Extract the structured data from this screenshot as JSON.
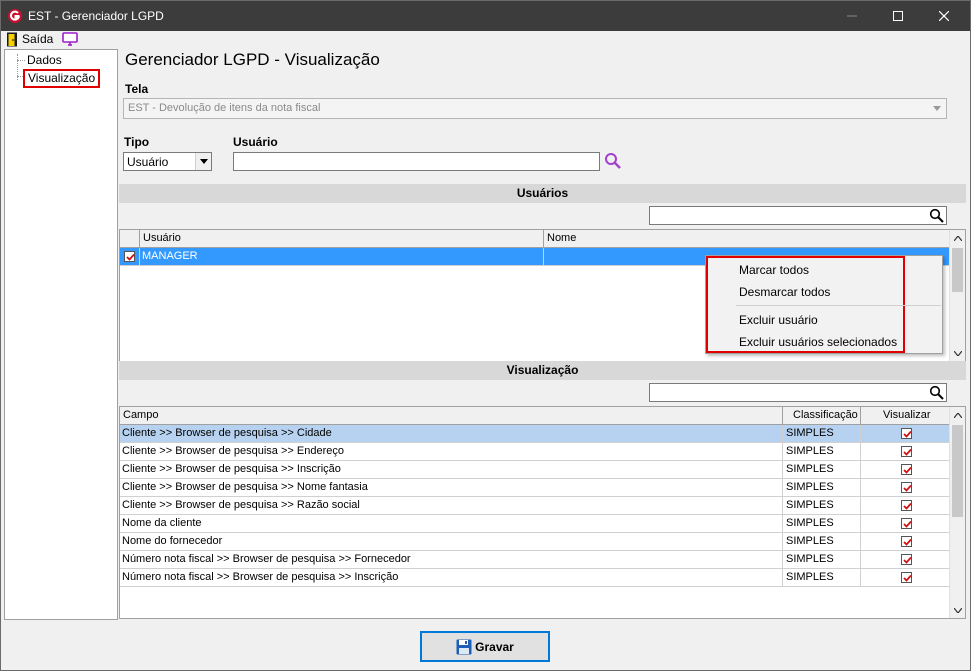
{
  "window": {
    "title": "EST - Gerenciador LGPD"
  },
  "menu": {
    "exit_label": "Saída"
  },
  "tree": {
    "items": [
      "Dados",
      "Visualização"
    ]
  },
  "page_title": "Gerenciador LGPD - Visualização",
  "tela": {
    "label": "Tela",
    "value": "EST - Devolução de itens da nota fiscal"
  },
  "tipo": {
    "label": "Tipo",
    "value": "Usuário"
  },
  "usuario": {
    "label": "Usuário",
    "value": ""
  },
  "sections": {
    "usuarios": "Usuários",
    "visualizacao": "Visualização"
  },
  "users_grid": {
    "columns": [
      "Usuário",
      "Nome"
    ],
    "rows": [
      {
        "usuario": "MANAGER",
        "nome": "",
        "checked": true
      }
    ]
  },
  "context_menu": {
    "items": [
      "Marcar todos",
      "Desmarcar todos",
      "Excluir usuário",
      "Excluir usuários selecionados"
    ]
  },
  "vis_grid": {
    "columns": [
      "Campo",
      "Classificação",
      "Visualizar"
    ],
    "rows": [
      {
        "campo": "Cliente >> Browser de pesquisa >> Cidade",
        "classificacao": "SIMPLES",
        "visualizar": true
      },
      {
        "campo": "Cliente >> Browser de pesquisa >> Endereço",
        "classificacao": "SIMPLES",
        "visualizar": true
      },
      {
        "campo": "Cliente >> Browser de pesquisa >> Inscrição",
        "classificacao": "SIMPLES",
        "visualizar": true
      },
      {
        "campo": "Cliente >> Browser de pesquisa >> Nome fantasia",
        "classificacao": "SIMPLES",
        "visualizar": true
      },
      {
        "campo": "Cliente >> Browser de pesquisa >> Razão social",
        "classificacao": "SIMPLES",
        "visualizar": true
      },
      {
        "campo": "Nome da cliente",
        "classificacao": "SIMPLES",
        "visualizar": true
      },
      {
        "campo": "Nome do fornecedor",
        "classificacao": "SIMPLES",
        "visualizar": true
      },
      {
        "campo": "Número nota fiscal >> Browser de pesquisa >> Fornecedor",
        "classificacao": "SIMPLES",
        "visualizar": true
      },
      {
        "campo": "Número nota fiscal >> Browser de pesquisa >> Inscrição",
        "classificacao": "SIMPLES",
        "visualizar": true
      }
    ]
  },
  "buttons": {
    "gravar": "Gravar"
  },
  "colors": {
    "accent": "#0078d7",
    "highlight_red": "#e00000",
    "selection": "#3399ff",
    "check": "#d01010"
  }
}
